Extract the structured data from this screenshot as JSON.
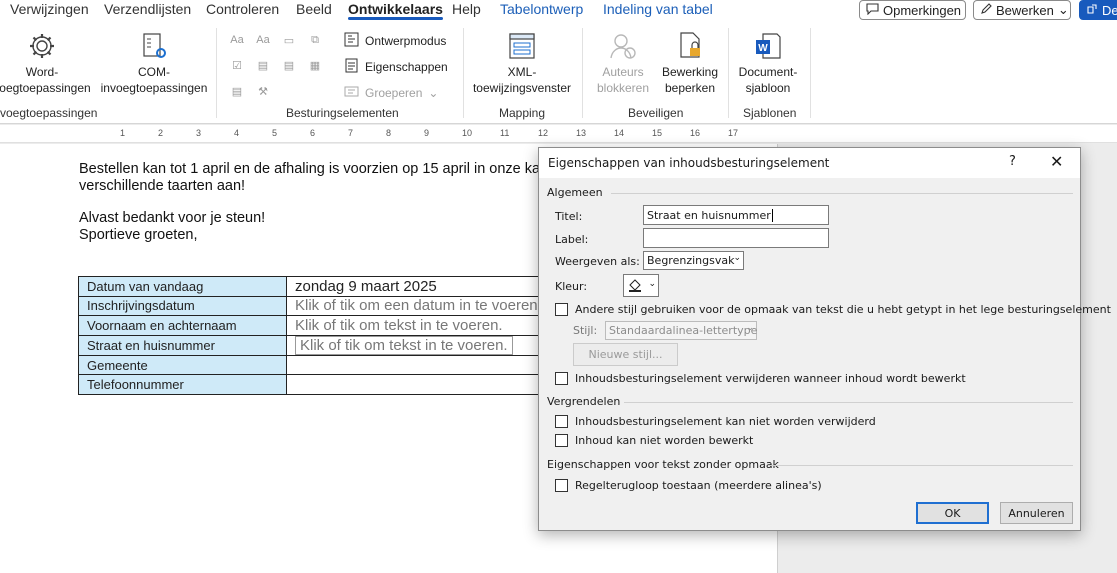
{
  "tabs": [
    "Verwijzingen",
    "Verzendlijsten",
    "Controleren",
    "Beeld",
    "Ontwikkelaars",
    "Help",
    "Tabelontwerp",
    "Indeling van tabel"
  ],
  "top_buttons": {
    "comments": "Opmerkingen",
    "edit": "Bewerken",
    "share": "De"
  },
  "ribbon": {
    "word_addins": "Word-\nvoegtoepassingen",
    "com_addins": "COM-\ninvoegtoepassingen",
    "group_addins": "voegtoepassingen",
    "design_mode": "Ontwerpmodus",
    "properties": "Eigenschappen",
    "group": "Groeperen",
    "group_controls": "Besturingselementen",
    "xml_pane": "XML-\ntoewijzingsvenster",
    "group_mapping": "Mapping",
    "block_authors": "Auteurs\nblokkeren",
    "restrict_editing": "Bewerking\nbeperken",
    "group_protect": "Beveiligen",
    "doc_template": "Document-\nsjabloon",
    "group_templates": "Sjablonen"
  },
  "ruler": [
    "1",
    "2",
    "3",
    "4",
    "5",
    "6",
    "7",
    "8",
    "9",
    "10",
    "11",
    "12",
    "13",
    "14",
    "15",
    "16",
    "17"
  ],
  "document": {
    "para1_line1": "Bestellen kan tot 1 april en de afhaling is voorzien op 15 april in onze ka",
    "para1_line2": "verschillende taarten aan!",
    "para2_line1": "Alvast bedankt voor je steun!",
    "para2_line2": "Sportieve groeten,",
    "table": [
      {
        "label": "Datum van vandaag",
        "value": "zondag 9 maart 2025",
        "placeholder": false
      },
      {
        "label": "Inschrijvingsdatum",
        "value": "Klik of tik om een datum in te voeren",
        "placeholder": true
      },
      {
        "label": "Voornaam en achternaam",
        "value": "Klik of tik om tekst in te voeren.",
        "placeholder": true
      },
      {
        "label": "Straat en huisnummer",
        "value": "Klik of tik om tekst in te voeren.",
        "placeholder": true
      },
      {
        "label": "Gemeente",
        "value": "",
        "placeholder": false
      },
      {
        "label": "Telefoonnummer",
        "value": "",
        "placeholder": false
      }
    ]
  },
  "dialog": {
    "title": "Eigenschappen van inhoudsbesturingselement",
    "help": "?",
    "close": "✕",
    "section_general": "Algemeen",
    "title_label": "Titel:",
    "title_value": "Straat en huisnummer",
    "tag_label": "Label:",
    "tag_value": "",
    "show_as_label": "Weergeven als:",
    "show_as_value": "Begrenzingsvak",
    "color_label": "Kleur:",
    "use_style": "Andere stijl gebruiken voor de opmaak van tekst die u hebt getypt in het lege besturingselement",
    "style_label": "Stijl:",
    "style_value": "Standaardalinea-lettertype",
    "new_style": "Nieuwe stijl...",
    "remove_when_edited": "Inhoudsbesturingselement verwijderen wanneer inhoud wordt bewerkt",
    "section_locking": "Vergrendelen",
    "cannot_delete": "Inhoudsbesturingselement kan niet worden verwijderd",
    "cannot_edit": "Inhoud kan niet worden bewerkt",
    "section_plaintext": "Eigenschappen voor tekst zonder opmaak",
    "allow_carriage": "Regelterugloop toestaan (meerdere alinea's)",
    "ok": "OK",
    "cancel": "Annuleren"
  },
  "colors": {
    "accent": "#185abd",
    "label_cell": "#cfeaf8",
    "contextual_tab": "#1c5fb8"
  }
}
